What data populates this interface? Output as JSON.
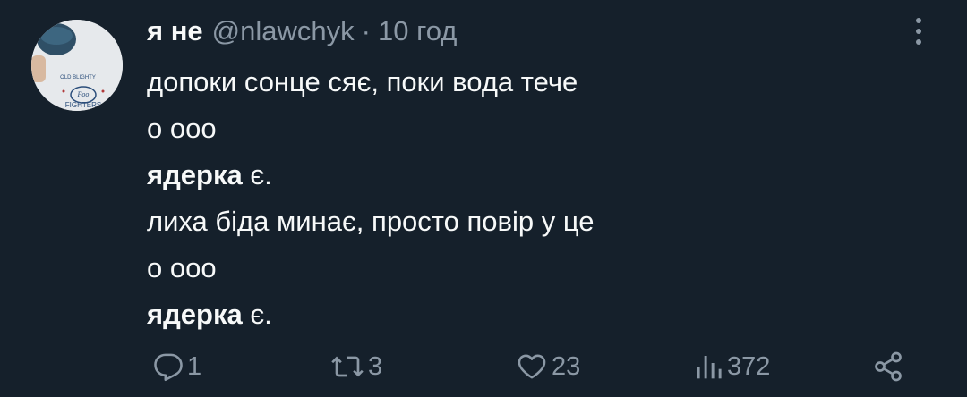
{
  "tweet": {
    "display_name": "я не",
    "handle": "@nlawchyk",
    "separator": "·",
    "time": "10 год",
    "avatar_shirt_top": "OLD BLIGHTY",
    "avatar_shirt_logo": "Foo",
    "avatar_shirt_bottom": "FIGHTERS",
    "lines": [
      {
        "bold": "",
        "text": "допоки сонце сяє, поки вода тече"
      },
      {
        "bold": "",
        "text": "о ооо"
      },
      {
        "bold": "ядерка",
        "text": " є."
      },
      {
        "bold": "",
        "text": "лиха біда минає, просто повір у це"
      },
      {
        "bold": "",
        "text": "о ооо"
      },
      {
        "bold": "ядерка",
        "text": " є."
      }
    ]
  },
  "actions": {
    "reply_count": "1",
    "retweet_count": "3",
    "like_count": "23",
    "views_count": "372"
  },
  "colors": {
    "background": "#15202b",
    "text": "#f7f9f9",
    "secondary": "#8b98a5"
  }
}
